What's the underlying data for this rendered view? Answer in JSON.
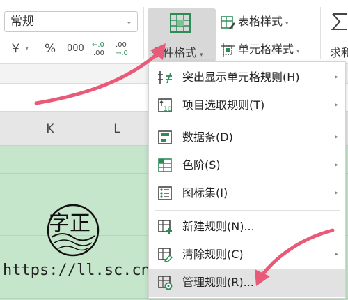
{
  "ribbon": {
    "number_format": {
      "value": "常规",
      "caret": "⌄"
    },
    "number_buttons": {
      "currency": "￥",
      "percent": "%",
      "thousands": "000",
      "increase_decimal": "←.0\n.00",
      "decrease_decimal": ".00\n→.0"
    },
    "conditional_format": {
      "label": "条件格式",
      "dropdown": "▾"
    },
    "table_style": {
      "label": "表格样式",
      "dropdown": "▾"
    },
    "cell_style": {
      "label": "单元格样式",
      "dropdown": "▾"
    },
    "sum": {
      "label": "求和"
    }
  },
  "columns": [
    "K",
    "L"
  ],
  "menu": {
    "items": [
      {
        "label": "突出显示单元格规则(H)",
        "icon": "highlight-rules-icon",
        "submenu": true
      },
      {
        "label": "项目选取规则(T)",
        "icon": "top-bottom-rules-icon",
        "submenu": true
      },
      {
        "label": "数据条(D)",
        "icon": "data-bars-icon",
        "submenu": true
      },
      {
        "label": "色阶(S)",
        "icon": "color-scales-icon",
        "submenu": true
      },
      {
        "label": "图标集(I)",
        "icon": "icon-sets-icon",
        "submenu": true
      },
      {
        "label": "新建规则(N)...",
        "icon": "new-rule-icon",
        "submenu": false
      },
      {
        "label": "清除规则(C)",
        "icon": "clear-rules-icon",
        "submenu": true
      },
      {
        "label": "管理规则(R)...",
        "icon": "manage-rules-icon",
        "submenu": false
      }
    ],
    "arrow_glyph": "▸"
  },
  "watermark": {
    "url": "https://ll.sc.cn"
  },
  "colors": {
    "sheet_green": "#c6e6cc",
    "annotation_arrow": "#e85a78",
    "active_button": "#d8d8d8",
    "icon_green": "#2e8b57"
  }
}
